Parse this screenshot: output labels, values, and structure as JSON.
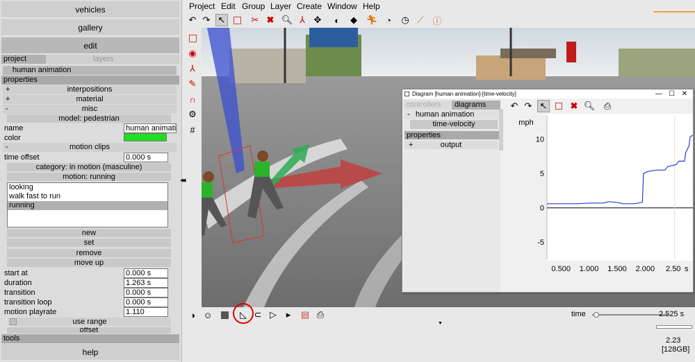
{
  "left_panel": {
    "vehicles": "vehicles",
    "gallery": "gallery",
    "edit": "edit",
    "tab_project": "project",
    "tab_layers": "layers",
    "project_item": "human animation",
    "properties_header": "properties",
    "interpositions": "interpositions",
    "material": "material",
    "misc": "misc",
    "model": "model: pedestrian",
    "name_label": "name",
    "name_value": "human animati",
    "color_label": "color",
    "color_value": "#22dd22",
    "motion_clips": "motion clips",
    "time_offset_label": "time offset",
    "time_offset_value": "0.000 s",
    "category": "category: in motion (masculine)",
    "motion": "motion: running",
    "motion_list": [
      "looking",
      "walk fast to run",
      "running"
    ],
    "new": "new",
    "set": "set",
    "remove": "remove",
    "move_up": "move up",
    "start_at_label": "start at",
    "start_at_value": "0.000 s",
    "duration_label": "duration",
    "duration_value": "1.263 s",
    "transition_label": "transition",
    "transition_value": "0.000 s",
    "transition_loop_label": "transition loop",
    "transition_loop_value": "0.000 s",
    "playrate_label": "motion playrate",
    "playrate_value": "1.110",
    "use_range": "use range",
    "offset": "offset",
    "tools": "tools",
    "help": "help",
    "plus": "+",
    "minus": "-"
  },
  "menubar": [
    "Project",
    "Edit",
    "Group",
    "Layer",
    "Create",
    "Window",
    "Help"
  ],
  "diagram": {
    "title": "Diagram [human animation]-[time-velocity]",
    "tab_controllers": "controllers",
    "tab_diagrams": "diagrams",
    "tree_item": "human animation",
    "tree_minus": "-",
    "sub_item": "time-velocity",
    "properties": "properties",
    "output_plus": "+",
    "output": "output",
    "unit": "mph"
  },
  "chart_data": {
    "type": "line",
    "title": "",
    "xlabel": "s",
    "ylabel": "mph",
    "xlim": [
      0.25,
      2.85
    ],
    "ylim": [
      -7.5,
      13.5
    ],
    "x_ticks": [
      "0.500",
      "1.000",
      "1.500",
      "2.000",
      "2.50"
    ],
    "y_ticks": [
      "10",
      "5",
      "0",
      "-5"
    ],
    "series": [
      {
        "values": [
          [
            0.25,
            0.6
          ],
          [
            0.8,
            0.6
          ],
          [
            1.0,
            0.7
          ],
          [
            1.25,
            0.7
          ],
          [
            1.35,
            0.9
          ],
          [
            1.5,
            0.8
          ],
          [
            1.6,
            0.6
          ],
          [
            1.8,
            0.6
          ],
          [
            1.95,
            0.8
          ],
          [
            1.97,
            5.0
          ],
          [
            2.05,
            5.3
          ],
          [
            2.2,
            5.5
          ],
          [
            2.35,
            5.5
          ],
          [
            2.4,
            6.0
          ],
          [
            2.55,
            6.3
          ],
          [
            2.6,
            6.8
          ],
          [
            2.7,
            6.8
          ],
          [
            2.72,
            8.0
          ],
          [
            2.75,
            8.5
          ],
          [
            2.78,
            9.0
          ],
          [
            2.8,
            10.3
          ],
          [
            2.85,
            10.6
          ]
        ]
      }
    ]
  },
  "bottom": {
    "time_label": "time",
    "time_value": "2.525 s",
    "time_fraction": 0.05,
    "version": "2.23",
    "memory": "[128GB]"
  }
}
